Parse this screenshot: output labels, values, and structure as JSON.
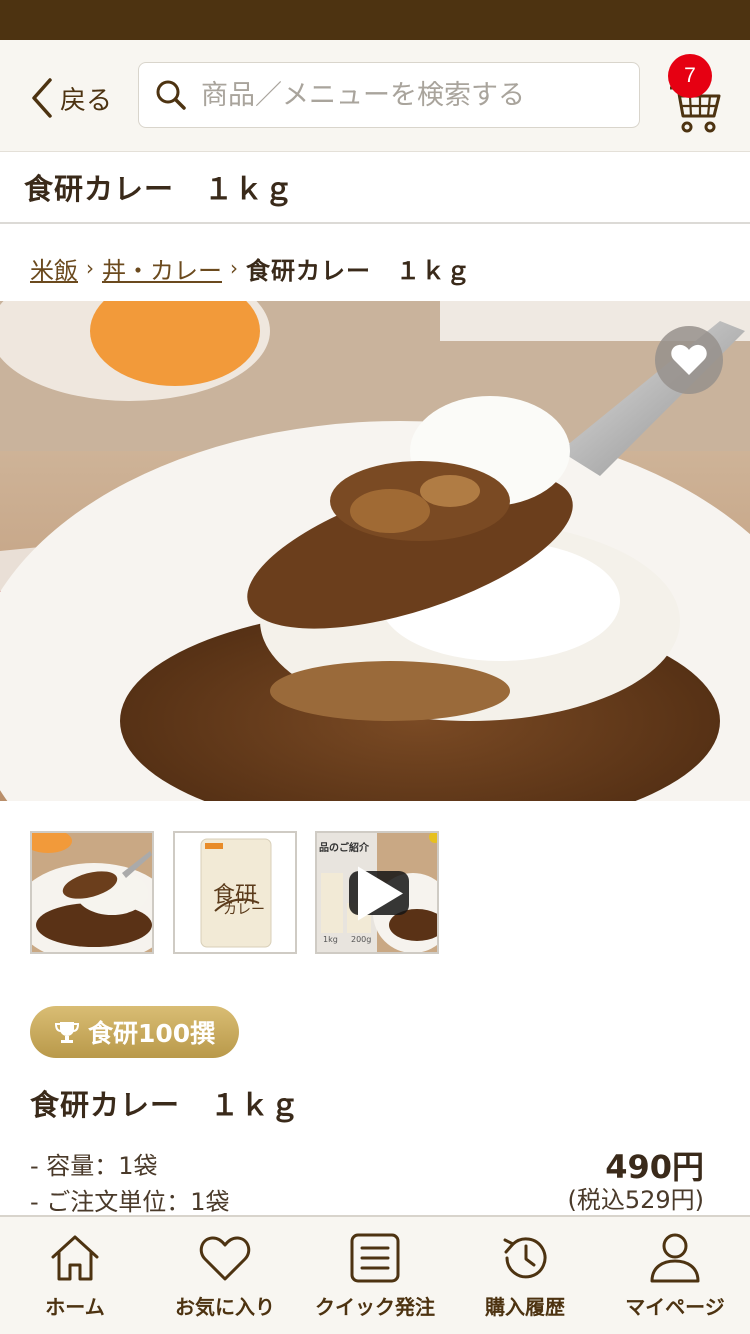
{
  "header": {
    "back_label": "戻る",
    "search_placeholder": "商品／メニューを検索する",
    "cart_count": "7"
  },
  "page_title": "食研カレー　１ｋｇ",
  "breadcrumb": {
    "items": [
      "米飯",
      "丼・カレー"
    ],
    "current": "食研カレー　１ｋｇ"
  },
  "thumbnails": {
    "video_caption": "品のご紹介",
    "video_sub1": "1kg",
    "video_sub2": "200g",
    "package_title": "食研",
    "package_sub": "カレー"
  },
  "product": {
    "badge": "食研100撰",
    "name": "食研カレー　１ｋｇ",
    "spec_volume": "- 容量：1袋",
    "spec_unit": "- ご注文単位：1袋",
    "price": "490円",
    "price_tax": "(税込529円)"
  },
  "tabs": [
    {
      "label": "ホーム",
      "icon": "home-icon"
    },
    {
      "label": "お気に入り",
      "icon": "heart-icon"
    },
    {
      "label": "クイック発注",
      "icon": "list-icon"
    },
    {
      "label": "購入履歴",
      "icon": "history-icon"
    },
    {
      "label": "マイページ",
      "icon": "person-icon"
    }
  ],
  "colors": {
    "brand_brown": "#4d3311",
    "badge_red": "#e60012",
    "gold": "#c9a85c"
  }
}
